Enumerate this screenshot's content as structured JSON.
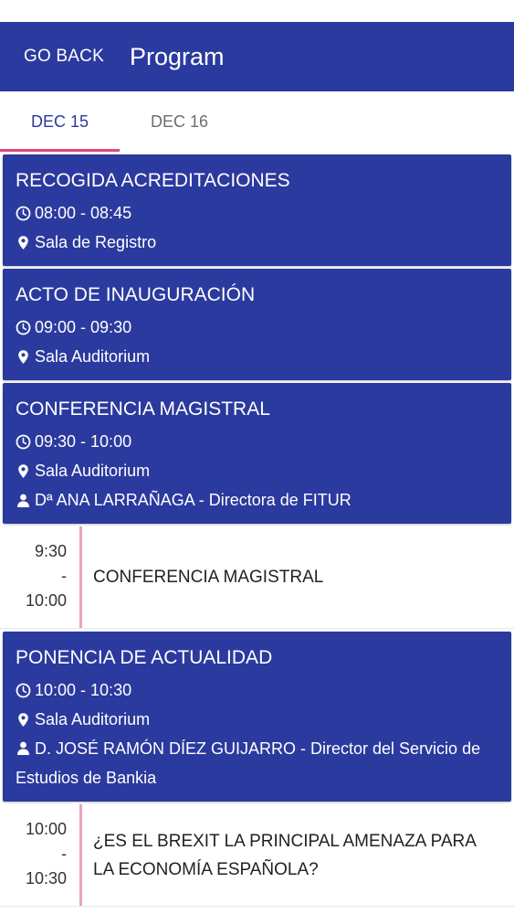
{
  "header": {
    "back_label": "GO BACK",
    "title": "Program"
  },
  "tabs": [
    {
      "label": "DEC 15",
      "active": true
    },
    {
      "label": "DEC 16",
      "active": false
    }
  ],
  "colors": {
    "primary": "#2b3a9e",
    "accent": "#e2457a",
    "timeline": "#e9a3bf"
  },
  "events": [
    {
      "title": "RECOGIDA ACREDITACIONES",
      "time": "08:00 - 08:45",
      "location": "Sala de Registro"
    },
    {
      "title": "ACTO DE INAUGURACIÓN",
      "time": "09:00 - 09:30",
      "location": "Sala Auditorium"
    },
    {
      "title": "CONFERENCIA MAGISTRAL",
      "time": "09:30 - 10:00",
      "location": "Sala Auditorium",
      "speaker": "Dª ANA LARRAÑAGA - Directora de FITUR",
      "session": {
        "start": "9:30",
        "separator": "-",
        "end": "10:00",
        "title": "CONFERENCIA MAGISTRAL"
      }
    },
    {
      "title": "PONENCIA DE ACTUALIDAD",
      "time": "10:00 - 10:30",
      "location": "Sala Auditorium",
      "speaker": "D. JOSÉ RAMÓN DÍEZ GUIJARRO - Director del Servicio de Estudios de Bankia",
      "session": {
        "start": "10:00",
        "separator": "-",
        "end": "10:30",
        "title": "¿ES EL BREXIT LA PRINCIPAL AMENAZA PARA LA ECONOMÍA ESPAÑOLA?"
      }
    }
  ]
}
